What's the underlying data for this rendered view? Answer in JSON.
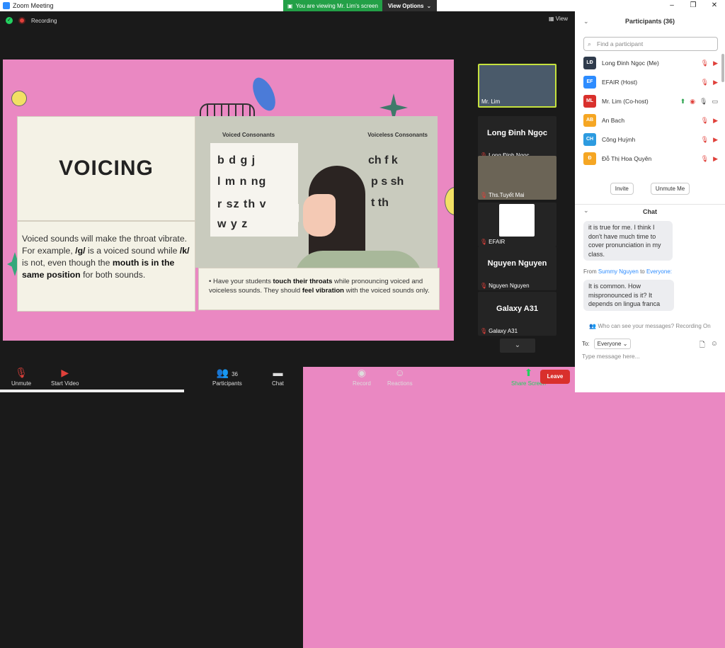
{
  "window": {
    "title": "Zoom Meeting",
    "viewing_banner": "You are viewing Mr. Lim's screen",
    "view_options": "View Options"
  },
  "topbar": {
    "recording": "Recording",
    "view": "View"
  },
  "slide": {
    "title": "VOICING",
    "desc_1": "Voiced sounds will make the throat vibrate. For example, ",
    "desc_g": "/g/",
    "desc_2": " is a voiced sound while ",
    "desc_k": "/k/",
    "desc_3": " is not, even though the ",
    "desc_bold": "mouth is in the same position",
    "desc_4": " for both sounds.",
    "voiced_title": "Voiced Consonants",
    "voiceless_title": "Voiceless Consonants",
    "voiced_rows": [
      "b  d  g  j",
      "l  m  n  ng",
      "r  sz  th  v",
      "w  y  z"
    ],
    "voiceless_rows": [
      "ch  f  k",
      "p  s  sh",
      "t  th"
    ],
    "tip_1": "Have your students ",
    "tip_b1": "touch their throats",
    "tip_2": " while pronouncing voiced and voiceless sounds. They should ",
    "tip_b2": "feel vibration",
    "tip_3": " with the voiced sounds only."
  },
  "thumbs": [
    {
      "big": "",
      "label": "Mr. Lim"
    },
    {
      "big": "Long Đinh Ngọc",
      "label": "Long Đinh Ngọc"
    },
    {
      "big": "",
      "label": "Ths.Tuyết Mai"
    },
    {
      "big": "",
      "label": "EFAIR"
    },
    {
      "big": "Nguyen Nguyen",
      "label": "Nguyen Nguyen"
    },
    {
      "big": "Galaxy A31",
      "label": "Galaxy A31"
    }
  ],
  "toolbar": {
    "unmute": "Unmute",
    "start_video": "Start Video",
    "participants": "Participants",
    "participants_count": "36",
    "chat": "Chat",
    "share_screen": "Share Screen",
    "record": "Record",
    "reactions": "Reactions",
    "leave": "Leave"
  },
  "sidebar": {
    "title": "Participants (36)",
    "find_placeholder": "Find a participant",
    "participants": [
      {
        "initials": "LĐ",
        "name": "Long Đinh Ngọc (Me)",
        "color": "#2f3b4c"
      },
      {
        "initials": "EF",
        "name": "EFAIR (Host)",
        "color": "#2d8cff"
      },
      {
        "initials": "ML",
        "name": "Mr. Lim (Co-host)",
        "color": "#d9302c"
      },
      {
        "initials": "AB",
        "name": "An Bach",
        "color": "#f5a623"
      },
      {
        "initials": "CH",
        "name": "Công Huỳnh",
        "color": "#2d9be0"
      },
      {
        "initials": "Đ",
        "name": "Đỗ Thị Hoa Quyên",
        "color": "#f5a623"
      }
    ],
    "invite": "Invite",
    "unmute_me": "Unmute Me",
    "chat_title": "Chat",
    "msg1": "it is true for me. I think I don't have much time to cover pronunciation in my class.",
    "from_label": "From",
    "from_name": "Summy Nguyen",
    "to_word": "to",
    "to_name": "Everyone:",
    "msg2": "It is common. How mispronounced is it? It depends on lingua franca",
    "who": "Who can see your messages? Recording On",
    "to": "To:",
    "to_value": "Everyone",
    "type_placeholder": "Type message here..."
  }
}
